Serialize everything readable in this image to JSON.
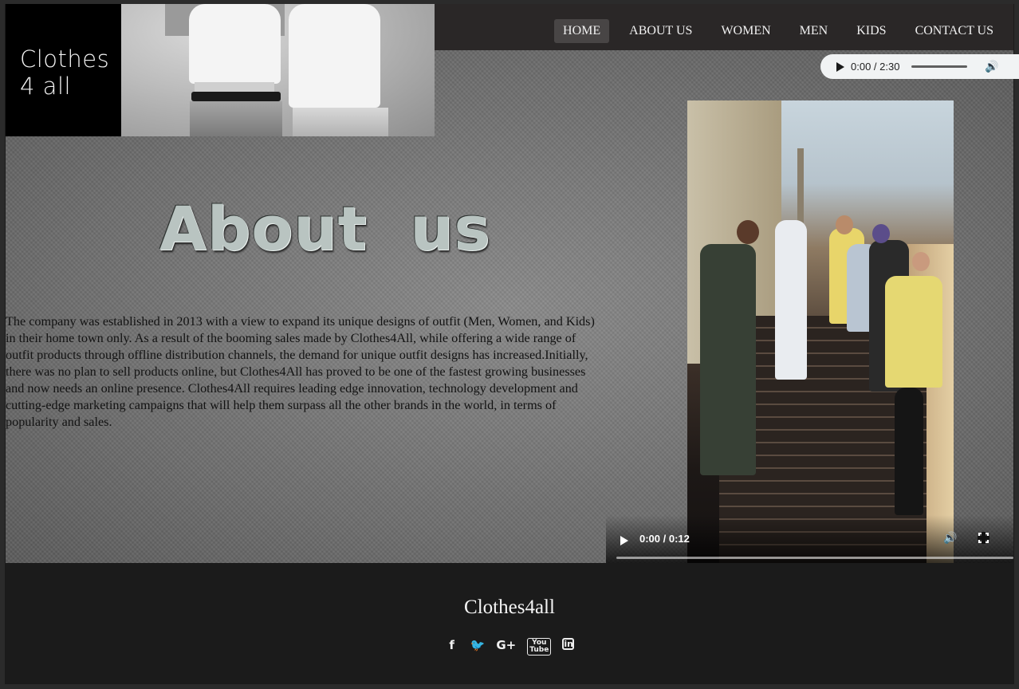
{
  "brand": {
    "logo_line1": "Clothes",
    "logo_line2": "4 all"
  },
  "nav": {
    "items": [
      {
        "label": "HOME",
        "active": true
      },
      {
        "label": "ABOUT US",
        "active": false
      },
      {
        "label": "WOMEN",
        "active": false
      },
      {
        "label": "MEN",
        "active": false
      },
      {
        "label": "KIDS",
        "active": false
      },
      {
        "label": "CONTACT US",
        "active": false
      }
    ]
  },
  "about": {
    "title": "About us",
    "text": "The company was established in 2013 with a view to expand its unique designs of outfit (Men, Women, and Kids) in their home town only. As a result of the booming sales made by Clothes4All, while offering a wide range of outfit products through offline distribution channels, the demand for unique outfit designs has increased.Initially, there was no plan to sell products online, but Clothes4All has proved to be one of the fastest growing businesses and now needs an online presence. Clothes4All requires leading edge innovation, technology development and cutting-edge marketing campaigns that will help them surpass all the other brands in the world, in terms of popularity and sales."
  },
  "audio": {
    "time": "0:00 / 2:30",
    "progress": 0
  },
  "video": {
    "time": "0:00 / 0:12",
    "progress": 0
  },
  "footer": {
    "brand": "Clothes4all",
    "socials": [
      {
        "name": "facebook-icon",
        "glyph": "f"
      },
      {
        "name": "twitter-icon",
        "glyph": "🐦"
      },
      {
        "name": "google-plus-icon",
        "glyph": "G+"
      },
      {
        "name": "youtube-icon",
        "glyph": "You Tube"
      },
      {
        "name": "linkedin-icon",
        "glyph": "in"
      }
    ]
  },
  "colors": {
    "header_bg": "#2a2727",
    "footer_bg": "#1b1b1b",
    "active_nav_bg": "#484545"
  }
}
